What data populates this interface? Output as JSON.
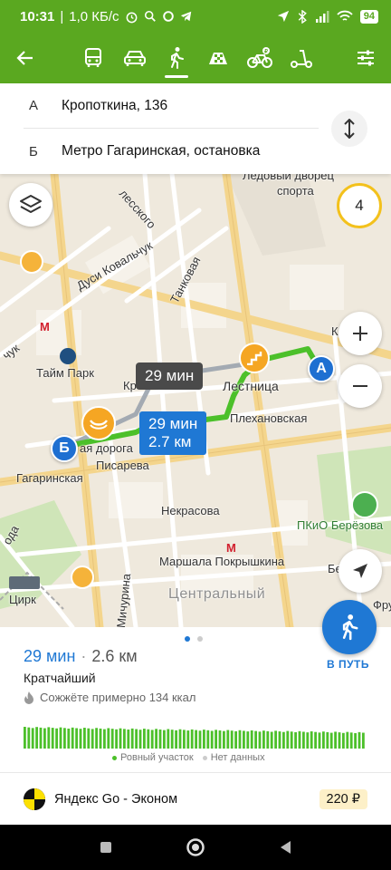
{
  "status_bar": {
    "time": "10:31",
    "speed": "1,0 КБ/с",
    "battery": "94"
  },
  "header": {
    "modes": [
      {
        "name": "bus",
        "icon": "bus-icon"
      },
      {
        "name": "car",
        "icon": "car-icon"
      },
      {
        "name": "walk",
        "icon": "walk-icon",
        "active": true
      },
      {
        "name": "taxi",
        "icon": "taxi-icon"
      },
      {
        "name": "bike",
        "icon": "bike-icon"
      },
      {
        "name": "scooter",
        "icon": "scooter-icon"
      }
    ]
  },
  "route": {
    "from_letter": "А",
    "from": "Кропоткина, 136",
    "to_letter": "Б",
    "to": "Метро Гагаринская, остановка"
  },
  "map": {
    "zoom": "4",
    "time_bubble_alt": "29 мин",
    "route_bubble_time": "29 мин",
    "route_bubble_dist": "2.7 км",
    "pin_a": "А",
    "pin_b": "Б",
    "labels": {
      "ice_palace_1": "Ледовый дворец",
      "ice_palace_2": "спорта",
      "dusi_kovalchuk": "Дуси Ковальчук",
      "tankovaya": "Танковая",
      "taim_park": "Тайм Парк",
      "lestnitsa": "Лестница",
      "plekhanovskaya": "Плехановская",
      "gagarinskaya": "Гагаринская",
      "doroga": "ая дорога",
      "pisareva": "Писарева",
      "nekrasova": "Некрасова",
      "marshala": "Маршала Покрышкина",
      "michurina": "Мичурина",
      "tsirk": "Цирк",
      "tsentralny": "Центральный",
      "pkio": "ПКиО Берёзова",
      "be": "Бе",
      "fru": "Фру",
      "kr": "Кр",
      "k": "К",
      "chuk": "чук",
      "da": "ода",
      "lesskogo": "лесского"
    }
  },
  "summary": {
    "time": "29 мин",
    "separator": "·",
    "distance": "2.6 км",
    "kind": "Кратчайший",
    "calories": "Сожжёте примерно 134 ккал",
    "go_label": "В ПУТЬ",
    "legend_flat": "Ровный участок",
    "legend_nodata": "Нет данных"
  },
  "taxi": {
    "name": "Яндекс Go - Эконом",
    "price": "220 ₽"
  },
  "colors": {
    "brand_green": "#5aa820",
    "route_green": "#4cc02a",
    "accent_blue": "#1f78d4"
  }
}
